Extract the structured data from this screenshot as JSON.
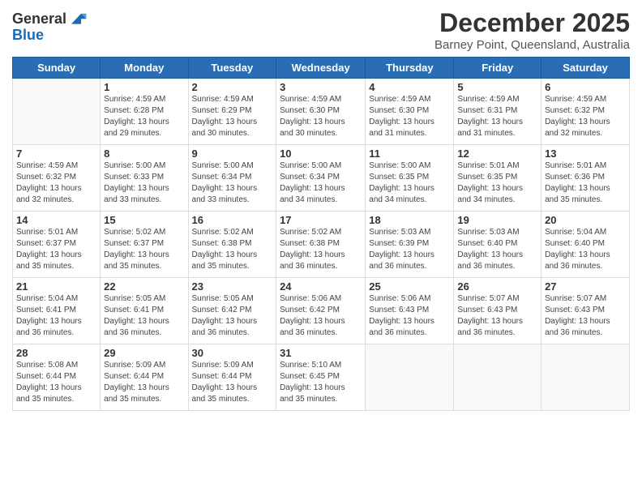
{
  "header": {
    "logo_line1": "General",
    "logo_line2": "Blue",
    "month_title": "December 2025",
    "subtitle": "Barney Point, Queensland, Australia"
  },
  "days_of_week": [
    "Sunday",
    "Monday",
    "Tuesday",
    "Wednesday",
    "Thursday",
    "Friday",
    "Saturday"
  ],
  "weeks": [
    [
      {
        "day": "",
        "info": ""
      },
      {
        "day": "1",
        "info": "Sunrise: 4:59 AM\nSunset: 6:28 PM\nDaylight: 13 hours\nand 29 minutes."
      },
      {
        "day": "2",
        "info": "Sunrise: 4:59 AM\nSunset: 6:29 PM\nDaylight: 13 hours\nand 30 minutes."
      },
      {
        "day": "3",
        "info": "Sunrise: 4:59 AM\nSunset: 6:30 PM\nDaylight: 13 hours\nand 30 minutes."
      },
      {
        "day": "4",
        "info": "Sunrise: 4:59 AM\nSunset: 6:30 PM\nDaylight: 13 hours\nand 31 minutes."
      },
      {
        "day": "5",
        "info": "Sunrise: 4:59 AM\nSunset: 6:31 PM\nDaylight: 13 hours\nand 31 minutes."
      },
      {
        "day": "6",
        "info": "Sunrise: 4:59 AM\nSunset: 6:32 PM\nDaylight: 13 hours\nand 32 minutes."
      }
    ],
    [
      {
        "day": "7",
        "info": "Sunrise: 4:59 AM\nSunset: 6:32 PM\nDaylight: 13 hours\nand 32 minutes."
      },
      {
        "day": "8",
        "info": "Sunrise: 5:00 AM\nSunset: 6:33 PM\nDaylight: 13 hours\nand 33 minutes."
      },
      {
        "day": "9",
        "info": "Sunrise: 5:00 AM\nSunset: 6:34 PM\nDaylight: 13 hours\nand 33 minutes."
      },
      {
        "day": "10",
        "info": "Sunrise: 5:00 AM\nSunset: 6:34 PM\nDaylight: 13 hours\nand 34 minutes."
      },
      {
        "day": "11",
        "info": "Sunrise: 5:00 AM\nSunset: 6:35 PM\nDaylight: 13 hours\nand 34 minutes."
      },
      {
        "day": "12",
        "info": "Sunrise: 5:01 AM\nSunset: 6:35 PM\nDaylight: 13 hours\nand 34 minutes."
      },
      {
        "day": "13",
        "info": "Sunrise: 5:01 AM\nSunset: 6:36 PM\nDaylight: 13 hours\nand 35 minutes."
      }
    ],
    [
      {
        "day": "14",
        "info": "Sunrise: 5:01 AM\nSunset: 6:37 PM\nDaylight: 13 hours\nand 35 minutes."
      },
      {
        "day": "15",
        "info": "Sunrise: 5:02 AM\nSunset: 6:37 PM\nDaylight: 13 hours\nand 35 minutes."
      },
      {
        "day": "16",
        "info": "Sunrise: 5:02 AM\nSunset: 6:38 PM\nDaylight: 13 hours\nand 35 minutes."
      },
      {
        "day": "17",
        "info": "Sunrise: 5:02 AM\nSunset: 6:38 PM\nDaylight: 13 hours\nand 36 minutes."
      },
      {
        "day": "18",
        "info": "Sunrise: 5:03 AM\nSunset: 6:39 PM\nDaylight: 13 hours\nand 36 minutes."
      },
      {
        "day": "19",
        "info": "Sunrise: 5:03 AM\nSunset: 6:40 PM\nDaylight: 13 hours\nand 36 minutes."
      },
      {
        "day": "20",
        "info": "Sunrise: 5:04 AM\nSunset: 6:40 PM\nDaylight: 13 hours\nand 36 minutes."
      }
    ],
    [
      {
        "day": "21",
        "info": "Sunrise: 5:04 AM\nSunset: 6:41 PM\nDaylight: 13 hours\nand 36 minutes."
      },
      {
        "day": "22",
        "info": "Sunrise: 5:05 AM\nSunset: 6:41 PM\nDaylight: 13 hours\nand 36 minutes."
      },
      {
        "day": "23",
        "info": "Sunrise: 5:05 AM\nSunset: 6:42 PM\nDaylight: 13 hours\nand 36 minutes."
      },
      {
        "day": "24",
        "info": "Sunrise: 5:06 AM\nSunset: 6:42 PM\nDaylight: 13 hours\nand 36 minutes."
      },
      {
        "day": "25",
        "info": "Sunrise: 5:06 AM\nSunset: 6:43 PM\nDaylight: 13 hours\nand 36 minutes."
      },
      {
        "day": "26",
        "info": "Sunrise: 5:07 AM\nSunset: 6:43 PM\nDaylight: 13 hours\nand 36 minutes."
      },
      {
        "day": "27",
        "info": "Sunrise: 5:07 AM\nSunset: 6:43 PM\nDaylight: 13 hours\nand 36 minutes."
      }
    ],
    [
      {
        "day": "28",
        "info": "Sunrise: 5:08 AM\nSunset: 6:44 PM\nDaylight: 13 hours\nand 35 minutes."
      },
      {
        "day": "29",
        "info": "Sunrise: 5:09 AM\nSunset: 6:44 PM\nDaylight: 13 hours\nand 35 minutes."
      },
      {
        "day": "30",
        "info": "Sunrise: 5:09 AM\nSunset: 6:44 PM\nDaylight: 13 hours\nand 35 minutes."
      },
      {
        "day": "31",
        "info": "Sunrise: 5:10 AM\nSunset: 6:45 PM\nDaylight: 13 hours\nand 35 minutes."
      },
      {
        "day": "",
        "info": ""
      },
      {
        "day": "",
        "info": ""
      },
      {
        "day": "",
        "info": ""
      }
    ]
  ]
}
